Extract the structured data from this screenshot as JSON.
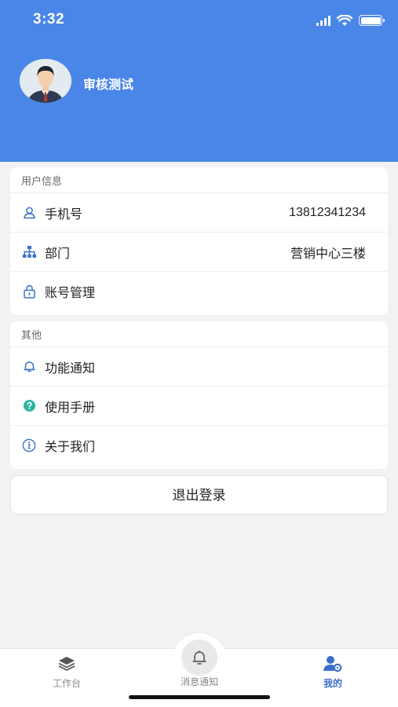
{
  "status_bar": {
    "time": "3:32"
  },
  "profile": {
    "name": "审核测试"
  },
  "user_info": {
    "title": "用户信息",
    "rows": [
      {
        "label": "手机号",
        "value": "13812341234",
        "icon": "user-icon"
      },
      {
        "label": "部门",
        "value": "营销中心三楼",
        "icon": "org-chart-icon"
      },
      {
        "label": "账号管理",
        "value": "",
        "icon": "lock-icon"
      }
    ]
  },
  "other": {
    "title": "其他",
    "rows": [
      {
        "label": "功能通知",
        "icon": "bell-icon"
      },
      {
        "label": "使用手册",
        "icon": "help-icon"
      },
      {
        "label": "关于我们",
        "icon": "info-icon"
      }
    ]
  },
  "logout_label": "退出登录",
  "tabbar": {
    "tabs": [
      {
        "label": "工作台",
        "icon": "stack-icon"
      },
      {
        "label": "消息通知",
        "icon": "bell-icon"
      },
      {
        "label": "我的",
        "icon": "user-settings-icon",
        "active": true
      }
    ]
  },
  "colors": {
    "brand": "#4a86e8",
    "active_tab": "#3a6fc8",
    "help_icon": "#2bb3a0"
  }
}
